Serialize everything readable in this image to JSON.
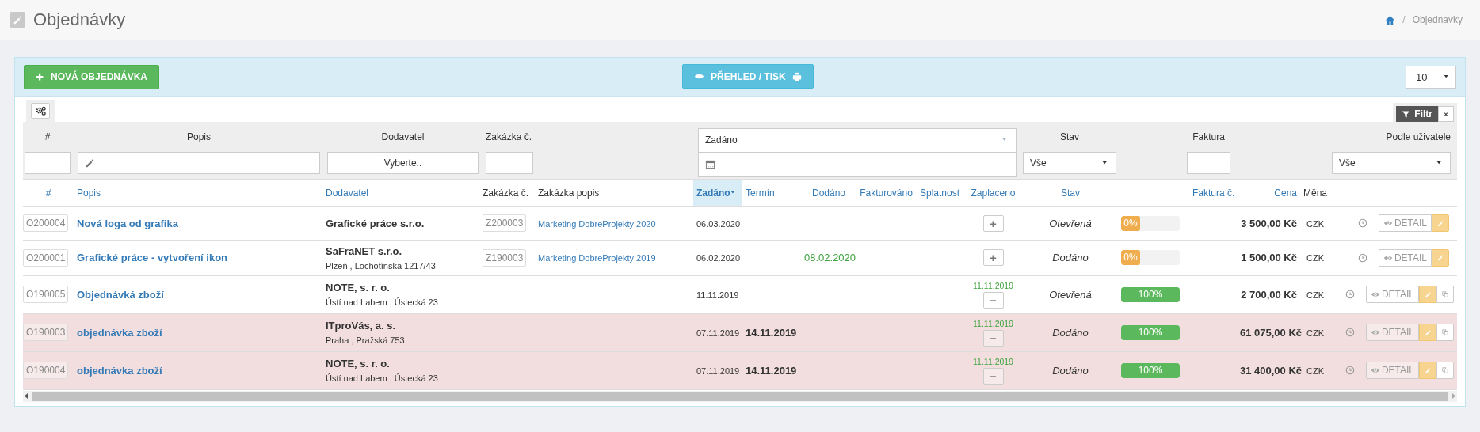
{
  "header": {
    "title": "Objednávky",
    "breadcrumb": [
      {
        "separator": "/",
        "label": "Objednavky"
      }
    ]
  },
  "toolbar": {
    "new_button": "NOVÁ OBJEDNÁVKA",
    "overview_button": "PŘEHLED / TISK",
    "page_size": "10"
  },
  "filters": {
    "filter_button": "Filtr",
    "fields": [
      {
        "kind": "input",
        "label": "#"
      },
      {
        "kind": "text",
        "label": "Popis"
      },
      {
        "kind": "picker",
        "label": "Dodavatel",
        "value": "Vyberte.."
      },
      {
        "kind": "input",
        "label": "Zakázka č."
      },
      {
        "kind": "daterange",
        "label": "Zadáno"
      },
      {
        "kind": "select",
        "label": "Stav",
        "value": "Vše"
      },
      {
        "kind": "input",
        "label": "Faktura"
      },
      {
        "kind": "select",
        "label": "Podle uživatele",
        "value": "Vše"
      }
    ]
  },
  "table": {
    "columns": [
      {
        "label": "#",
        "sortable": true,
        "sorted": false
      },
      {
        "label": "Popis",
        "sortable": true,
        "sorted": false
      },
      {
        "label": "Dodavatel",
        "sortable": true,
        "sorted": false
      },
      {
        "label": "Zakázka č.",
        "sortable": false,
        "sorted": false
      },
      {
        "label": "Zakázka popis",
        "sortable": false,
        "sorted": false
      },
      {
        "label": "Zadáno",
        "sortable": true,
        "sorted": true
      },
      {
        "label": "Termín",
        "sortable": true,
        "sorted": false
      },
      {
        "label": "Dodáno",
        "sortable": true,
        "sorted": false
      },
      {
        "label": "Fakturováno",
        "sortable": true,
        "sorted": false
      },
      {
        "label": "Splatnost",
        "sortable": true,
        "sorted": false
      },
      {
        "label": "Zaplaceno",
        "sortable": true,
        "sorted": false
      },
      {
        "label": "Stav",
        "sortable": true,
        "sorted": false
      },
      {
        "label": "Faktura č.",
        "sortable": true,
        "sorted": false
      },
      {
        "label": "Cena",
        "sortable": true,
        "sorted": false
      },
      {
        "label": "Měna",
        "sortable": false,
        "sorted": false
      }
    ],
    "rows": [
      {
        "number": "O200004",
        "title": "Nová loga od grafika",
        "supplier": "Grafické práce s.r.o.",
        "order_no": "Z200003",
        "order_desc": "Marketing DobreProjekty 2020",
        "created": "06.03.2020",
        "paid_button": "+",
        "status": "Otevřená",
        "level": 0,
        "level_text": "0%",
        "price": "3 500,00 Kč",
        "currency": "CZK",
        "detail_button": "DETAIL",
        "highlighted": false,
        "copyable": false
      },
      {
        "number": "O200001",
        "title": "Grafické práce - vytvoření ikon",
        "supplier": "SaFraNET s.r.o.",
        "address": "Plzeň , Lochotínská 1217/43",
        "order_no": "Z190003",
        "order_desc": "Marketing DobreProjekty 2019",
        "created": "06.02.2020",
        "delivered": "08.02.2020",
        "paid_button": "+",
        "status": "Dodáno",
        "level": 0,
        "level_text": "0%",
        "price": "1 500,00 Kč",
        "currency": "CZK",
        "detail_button": "DETAIL",
        "highlighted": false,
        "copyable": false
      },
      {
        "number": "O190005",
        "title": "Objednávká zboží",
        "supplier": "NOTE, s. r. o.",
        "address": "Ústí nad Labem , Ústecká 23",
        "created": "11.11.2019",
        "paid_date": "11.11.2019",
        "paid_button": "−",
        "status": "Otevřená",
        "level": 1,
        "level_text": "100%",
        "price": "2 700,00 Kč",
        "currency": "CZK",
        "detail_button": "DETAIL",
        "highlighted": false,
        "copyable": true
      },
      {
        "number": "O190003",
        "title": "objednávka zboží",
        "supplier": "ITproVás, a. s.",
        "address": "Praha , Pražská 753",
        "created": "07.11.2019",
        "deadline": "14.11.2019",
        "paid_date": "11.11.2019",
        "paid_button": "−",
        "status": "Dodáno",
        "level": 1,
        "level_text": "100%",
        "price": "61 075,00 Kč",
        "currency": "CZK",
        "detail_button": "DETAIL",
        "highlighted": true,
        "copyable": true
      },
      {
        "number": "O190004",
        "title": "objednávka zboží",
        "supplier": "NOTE, s. r. o.",
        "address": "Ústí nad Labem , Ústecká 23",
        "created": "07.11.2019",
        "deadline": "14.11.2019",
        "paid_date": "11.11.2019",
        "paid_button": "−",
        "status": "Dodáno",
        "level": 1,
        "level_text": "100%",
        "price": "31 400,00 Kč",
        "currency": "CZK",
        "detail_button": "DETAIL",
        "highlighted": true,
        "copyable": true
      }
    ]
  }
}
